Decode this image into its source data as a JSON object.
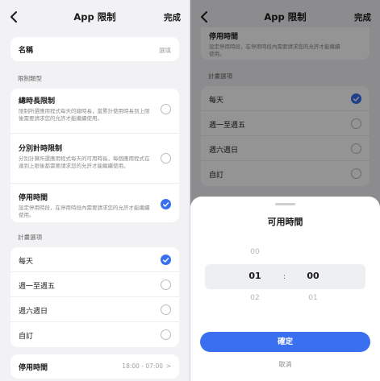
{
  "left": {
    "nav": {
      "title": "App 限制",
      "done": "完成"
    },
    "name_row": {
      "label": "名稱",
      "value": "選填"
    },
    "limit_type_header": "限制類型",
    "limit_types": [
      {
        "label": "總時長限制",
        "desc": "限制所選應用程式每天的總時長，當累計使用時長到上限後需要請求您的允許才能繼續使用。",
        "checked": false
      },
      {
        "label": "分別計時限制",
        "desc": "分別計算所選應用程式每天的可用時長，每個應用程式在達到上限後都需要請求您的允許才能繼續使用。",
        "checked": false
      },
      {
        "label": "停用時間",
        "desc": "設定停用時段，在停用時段內需要請求您的允許才能繼續使用。",
        "checked": true
      }
    ],
    "schedule_header": "計畫選項",
    "schedule_options": [
      {
        "label": "每天",
        "checked": true
      },
      {
        "label": "週一至週五",
        "checked": false
      },
      {
        "label": "週六週日",
        "checked": false
      },
      {
        "label": "自訂",
        "checked": false
      }
    ],
    "downtime_row": {
      "label": "停用時間",
      "value": "18:00 - 07:00",
      "chevron": ">"
    }
  },
  "right": {
    "nav": {
      "title": "App 限制",
      "done": "完成"
    },
    "top_card": {
      "label": "停用時間",
      "desc": "設定停用時段，在停用時段內需要請求您的允許才能繼續使用。"
    },
    "schedule_header": "計畫選項",
    "schedule_options": [
      {
        "label": "每天",
        "checked": true
      },
      {
        "label": "週一至週五",
        "checked": false
      },
      {
        "label": "週六週日",
        "checked": false
      },
      {
        "label": "自訂",
        "checked": false
      }
    ],
    "sheet": {
      "title": "可用時間",
      "hours": {
        "above": "00",
        "selected": "01",
        "below": "02"
      },
      "colon": ":",
      "minutes": {
        "selected": "00",
        "below": "01"
      },
      "confirm": "確定",
      "cancel": "取消"
    }
  },
  "colors": {
    "accent": "#3a6ff0",
    "background": "#f2f2f4"
  }
}
